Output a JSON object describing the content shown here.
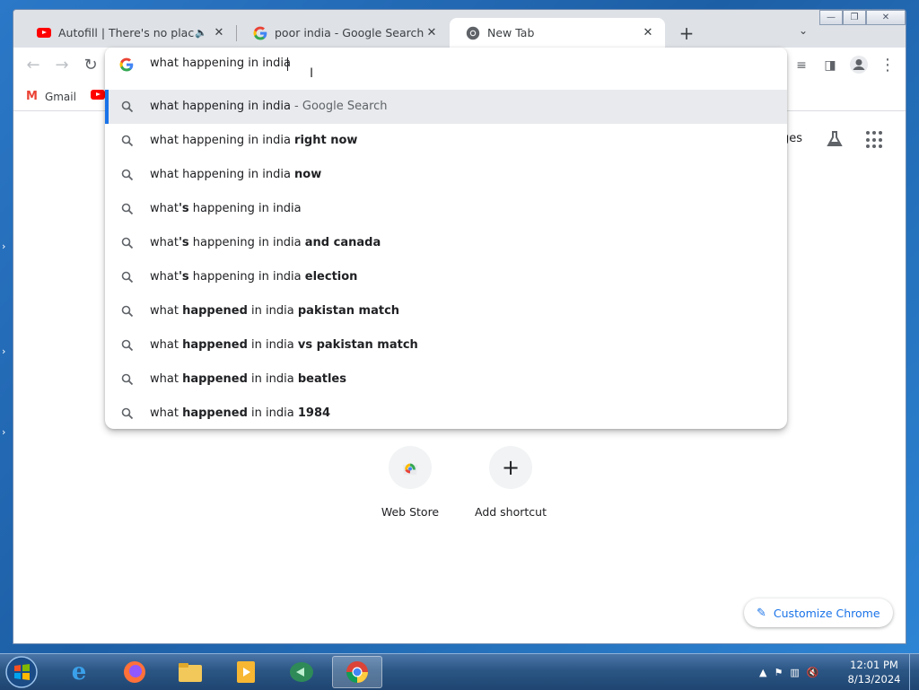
{
  "tabs": [
    {
      "title": "Autofill | There's no place like",
      "favicon": "youtube-icon",
      "muted": true
    },
    {
      "title": "poor india - Google Search",
      "favicon": "google-icon"
    },
    {
      "title": "New Tab",
      "favicon": "chrome-icon",
      "active": true
    }
  ],
  "omnibox": {
    "value": "what happening in india ",
    "suggestions": [
      {
        "parts": [
          {
            "t": "what happening in india",
            "b": false
          }
        ],
        "suffix": " - Google Search",
        "selected": true
      },
      {
        "parts": [
          {
            "t": "what happening in india ",
            "b": false
          },
          {
            "t": "right now",
            "b": true
          }
        ]
      },
      {
        "parts": [
          {
            "t": "what happening in india ",
            "b": false
          },
          {
            "t": "now",
            "b": true
          }
        ]
      },
      {
        "parts": [
          {
            "t": "what",
            "b": false
          },
          {
            "t": "'s",
            "b": true
          },
          {
            "t": " happening in india",
            "b": false
          }
        ]
      },
      {
        "parts": [
          {
            "t": "what",
            "b": false
          },
          {
            "t": "'s",
            "b": true
          },
          {
            "t": " happening in india ",
            "b": false
          },
          {
            "t": "and canada",
            "b": true
          }
        ]
      },
      {
        "parts": [
          {
            "t": "what",
            "b": false
          },
          {
            "t": "'s",
            "b": true
          },
          {
            "t": " happening in india ",
            "b": false
          },
          {
            "t": "election",
            "b": true
          }
        ]
      },
      {
        "parts": [
          {
            "t": "what ",
            "b": false
          },
          {
            "t": "happened",
            "b": true
          },
          {
            "t": " in india ",
            "b": false
          },
          {
            "t": "pakistan match",
            "b": true
          }
        ]
      },
      {
        "parts": [
          {
            "t": "what ",
            "b": false
          },
          {
            "t": "happened",
            "b": true
          },
          {
            "t": " in india ",
            "b": false
          },
          {
            "t": "vs pakistan match",
            "b": true
          }
        ]
      },
      {
        "parts": [
          {
            "t": "what ",
            "b": false
          },
          {
            "t": "happened",
            "b": true
          },
          {
            "t": " in india ",
            "b": false
          },
          {
            "t": "beatles",
            "b": true
          }
        ]
      },
      {
        "parts": [
          {
            "t": "what ",
            "b": false
          },
          {
            "t": "happened",
            "b": true
          },
          {
            "t": " in india ",
            "b": false
          },
          {
            "t": "1984",
            "b": true
          }
        ]
      }
    ]
  },
  "bookmarks": {
    "gmail": "Gmail"
  },
  "ntp": {
    "images_link": "ges",
    "shortcuts": [
      {
        "label": "Web Store",
        "icon": "web-store-icon"
      },
      {
        "label": "Add shortcut",
        "icon": "plus-icon"
      }
    ],
    "customize_label": "Customize Chrome"
  },
  "taskbar": {
    "apps": [
      "internet-explorer-icon",
      "firefox-icon",
      "file-explorer-icon",
      "media-player-icon",
      "app-icon",
      "chrome-icon"
    ],
    "clock_time": "12:01 PM",
    "clock_date": "8/13/2024"
  },
  "colors": {
    "accent": "#1a73e8",
    "selected_row": "#e8eaed"
  }
}
